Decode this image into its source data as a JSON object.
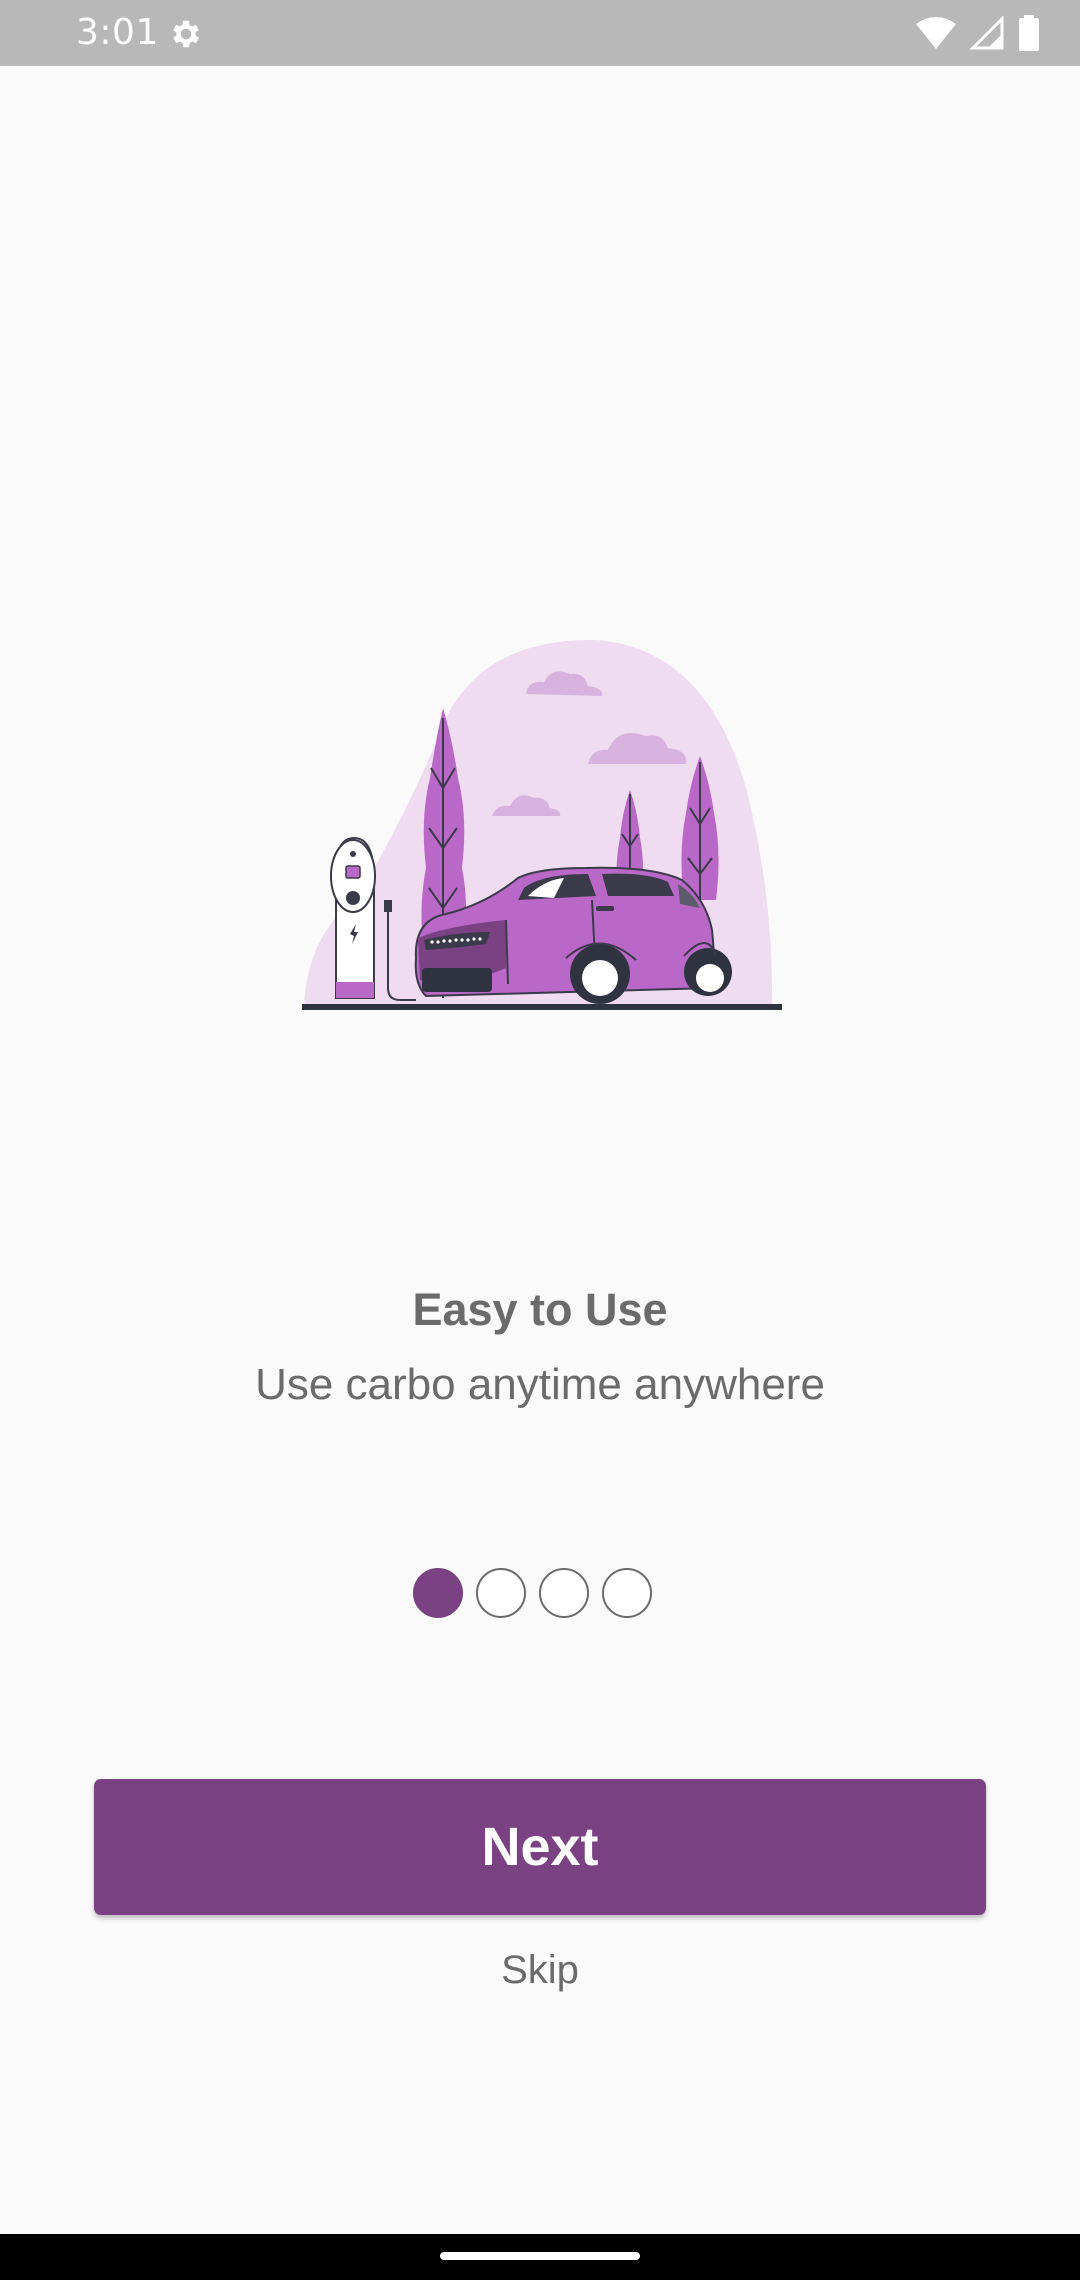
{
  "status_bar": {
    "time": "3:01",
    "icons": [
      "gear-icon",
      "wifi-icon",
      "signal-icon",
      "battery-icon"
    ]
  },
  "onboarding": {
    "illustration": "electric-car-charging-illustration",
    "title": "Easy to Use",
    "subtitle": "Use carbo anytime anywhere",
    "page_indicator": {
      "total": 4,
      "active_index": 0
    },
    "next_label": "Next",
    "skip_label": "Skip"
  },
  "colors": {
    "accent": "#7a4183",
    "text": "#6b6b6b",
    "background": "#fafafa",
    "status_bar": "#b8b8b8",
    "illustration_purple": "#ba68c8",
    "illustration_light": "#efdcf1"
  }
}
